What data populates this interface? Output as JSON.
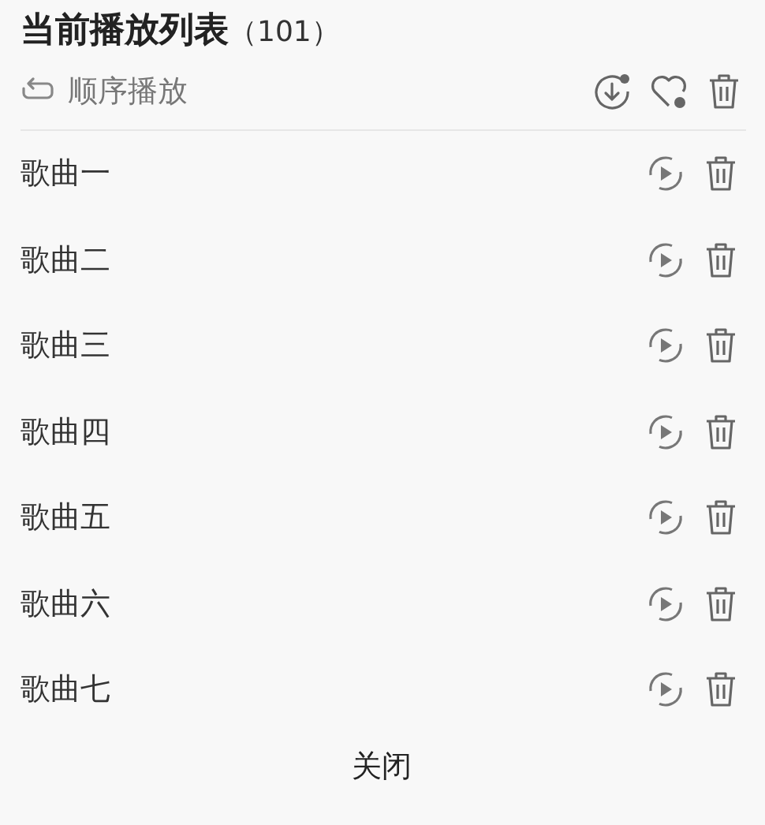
{
  "title": "当前播放列表",
  "count": "（101）",
  "play_mode": "顺序播放",
  "songs": [
    {
      "name": "歌曲一"
    },
    {
      "name": "歌曲二"
    },
    {
      "name": "歌曲三"
    },
    {
      "name": "歌曲四"
    },
    {
      "name": "歌曲五"
    },
    {
      "name": "歌曲六"
    },
    {
      "name": "歌曲七"
    }
  ],
  "close_button": "关闭"
}
